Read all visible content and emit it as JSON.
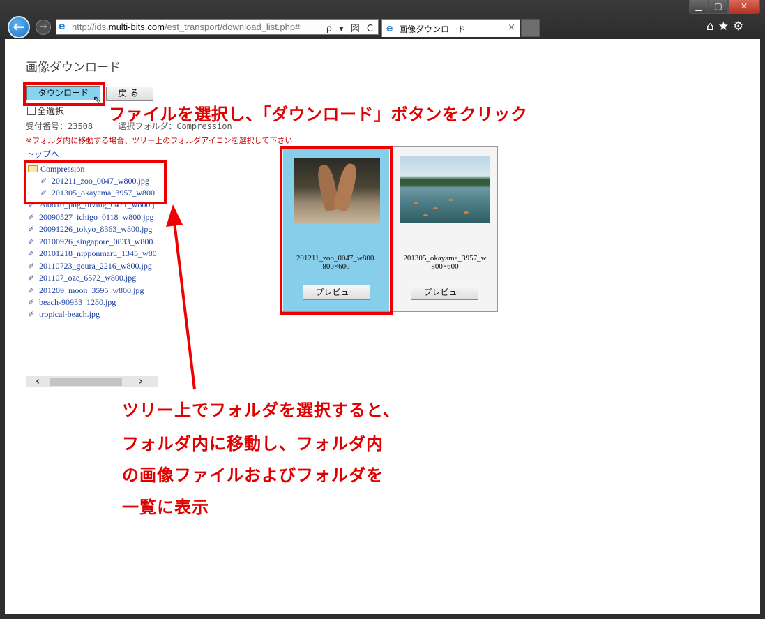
{
  "browser": {
    "address_url_prefix": "http://ids.",
    "address_url_domain": "multi-bits.com",
    "address_url_path": "/est_transport/download_list.php#",
    "address_tools": "ρ ▾ 図 C",
    "tab_title": "画像ダウンロード",
    "tab_close": "×",
    "window_min": "▁",
    "window_max": "▢",
    "window_close": "✕",
    "back_glyph": "←",
    "fwd_glyph": "→",
    "right_icons": "⌂★⚙"
  },
  "page": {
    "title": "画像ダウンロード",
    "download_button": "ダウンロード",
    "back_button": "戻る",
    "select_all": "全選択",
    "receipt_label": "受付番号：23508",
    "folder_label": "選択フォルダ：Compression",
    "note": "※フォルダ内に移動する場合、ツリー上のフォルダアイコンを選択して下さい",
    "top_link": "トップへ"
  },
  "tree": {
    "folder": "Compression",
    "children": [
      "201211_zoo_0047_w800.jpg",
      "201305_okayama_3957_w800."
    ],
    "files": [
      "200810_png_diving_0471_w800.j",
      "20090527_ichigo_0118_w800.jpg",
      "20091226_tokyo_8363_w800.jpg",
      "20100926_singapore_0833_w800.",
      "20101218_nipponmaru_1345_w80",
      "20110723_goura_2216_w800.jpg",
      "201107_oze_6572_w800.jpg",
      "201209_moon_3595_w800.jpg",
      "beach-90933_1280.jpg",
      "tropical-beach.jpg"
    ]
  },
  "scrollbar": {
    "left": "‹",
    "right": "›"
  },
  "gallery": [
    {
      "name": "201211_zoo_0047_w800.",
      "size": "800×600",
      "preview": "プレビュー",
      "selected": true
    },
    {
      "name": "201305_okayama_3957_w",
      "size": "800×600",
      "preview": "プレビュー",
      "selected": false
    }
  ],
  "annotations": {
    "top": "ファイルを選択し、「ダウンロード」ボタンをクリック",
    "bottom": [
      "ツリー上でフォルダを選択すると、",
      "フォルダ内に移動し、フォルダ内",
      "の画像ファイルおよびフォルダを",
      "一覧に表示"
    ],
    "color": "#e00000"
  },
  "colors": {
    "selected_card": "#87ceeb",
    "link": "#1a3fa0",
    "note": "#cc0000"
  }
}
